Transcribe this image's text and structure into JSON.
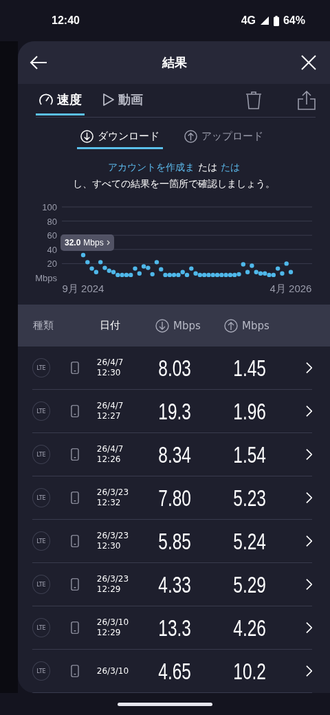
{
  "status_bar": {
    "time": "12:40",
    "network": "4G",
    "battery": "64%"
  },
  "header": {
    "title": "結果"
  },
  "tabs": [
    {
      "label": "速度",
      "kind": "gauge",
      "selected": true
    },
    {
      "label": "動画",
      "kind": "play",
      "selected": false
    }
  ],
  "direction_tabs": [
    {
      "label": "ダウンロード",
      "kind": "down",
      "selected": true
    },
    {
      "label": "アップロード",
      "kind": "up",
      "selected": false
    }
  ],
  "notice": {
    "line_1": [
      {
        "text": "アカウントを作成ま",
        "kind": "link"
      },
      {
        "text": "たは",
        "kind": "plain"
      },
      {
        "text": "たは",
        "kind": "link"
      }
    ],
    "line_2": "し、すべての結果を一箇所で確認しましょう。"
  },
  "chart": {
    "tooltip": {
      "value": "32.0",
      "unit": "Mbps"
    },
    "chart_data": {
      "type": "scatter",
      "categories": [
        "9月 2024",
        null,
        null,
        null,
        null,
        null,
        null,
        null,
        null,
        null,
        null,
        null,
        null,
        null,
        null,
        null,
        null,
        null,
        null,
        null,
        null,
        null,
        null,
        null,
        null,
        null,
        null,
        null,
        null,
        null,
        null,
        null,
        null,
        null,
        null,
        null,
        null,
        null,
        null,
        null,
        null,
        null,
        null,
        null,
        null,
        null,
        null,
        null,
        "4月 2026"
      ],
      "series": [
        {
          "color": "#4fb8ea",
          "values": [
            32,
            22,
            13,
            8,
            22,
            14,
            10,
            8,
            4,
            4,
            4,
            4,
            13,
            6,
            16,
            14,
            5,
            22,
            12,
            4,
            4,
            4,
            4,
            8,
            4,
            13,
            6,
            4,
            4,
            4,
            4,
            4,
            4,
            4,
            4,
            4,
            5,
            19,
            8,
            17,
            8,
            6,
            6,
            4,
            4,
            13,
            6,
            20,
            8
          ]
        }
      ],
      "ylim": [
        0,
        100
      ],
      "grid": true,
      "yticks": [
        {
          "value": 0,
          "label": "Mbps"
        },
        20,
        40,
        60,
        80,
        100
      ]
    }
  },
  "table": {
    "columns": [
      {
        "label": "種類",
        "kind": "text"
      },
      {
        "label": "日付",
        "kind": "text"
      },
      {
        "label": "Mbps",
        "kind": "down"
      },
      {
        "label": "Mbps",
        "kind": "up"
      }
    ],
    "rows": [
      {
        "type": "LTE",
        "date": "26/4/7",
        "time": "12:30",
        "download": "8.03",
        "upload": "1.45"
      },
      {
        "type": "LTE",
        "date": "26/4/7",
        "time": "12:27",
        "download": "19.3",
        "upload": "1.96"
      },
      {
        "type": "LTE",
        "date": "26/4/7",
        "time": "12:26",
        "download": "8.34",
        "upload": "1.54"
      },
      {
        "type": "LTE",
        "date": "26/3/23",
        "time": "12:32",
        "download": "7.80",
        "upload": "5.23"
      },
      {
        "type": "LTE",
        "date": "26/3/23",
        "time": "12:30",
        "download": "5.85",
        "upload": "5.24"
      },
      {
        "type": "LTE",
        "date": "26/3/23",
        "time": "12:29",
        "download": "4.33",
        "upload": "5.29"
      },
      {
        "type": "LTE",
        "date": "26/3/10",
        "time": "12:29",
        "download": "13.3",
        "upload": "4.26"
      },
      {
        "type": "LTE",
        "date": "26/3/10",
        "download": "4.65",
        "upload": "10.2"
      }
    ]
  }
}
